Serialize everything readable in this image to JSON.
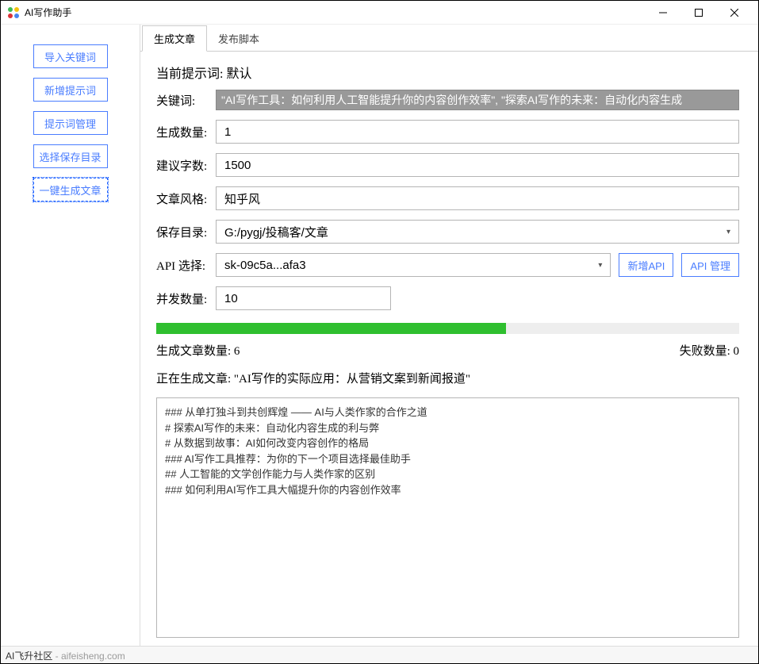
{
  "window": {
    "title": "AI写作助手"
  },
  "sidebar": {
    "import_keywords": "导入关键词",
    "add_prompt": "新增提示词",
    "manage_prompts": "提示词管理",
    "choose_save_dir": "选择保存目录",
    "one_click_generate": "一键生成文章"
  },
  "tabs": {
    "generate": "生成文章",
    "publish": "发布脚本"
  },
  "form": {
    "current_prompt_label": "当前提示词: 默认",
    "keyword_label": "关键词:",
    "keyword_value": "\"AI写作工具：如何利用人工智能提升你的内容创作效率\", \"探索AI写作的未来：自动化内容生成",
    "count_label": "生成数量:",
    "count_value": "1",
    "words_label": "建议字数:",
    "words_value": "1500",
    "style_label": "文章风格:",
    "style_value": "知乎风",
    "savedir_label": "保存目录:",
    "savedir_value": "G:/pygj/投稿客/文章",
    "api_label": "API 选择:",
    "api_value": "sk-09c5a...afa3",
    "add_api_btn": "新增API",
    "manage_api_btn": "API 管理",
    "concurrency_label": "并发数量:",
    "concurrency_value": "10"
  },
  "progress": {
    "percent": 60
  },
  "status": {
    "generated_label": "生成文章数量: ",
    "generated_count": "6",
    "failed_label": "失败数量: ",
    "failed_count": "0",
    "current_generating": "正在生成文章: \"AI写作的实际应用：从营销文案到新闻报道\""
  },
  "log": {
    "lines": [
      "### 从单打独斗到共创辉煌 —— AI与人类作家的合作之道",
      "# 探索AI写作的未来：自动化内容生成的利与弊",
      "# 从数据到故事：AI如何改变内容创作的格局",
      "### AI写作工具推荐：为你的下一个项目选择最佳助手",
      "## 人工智能的文学创作能力与人类作家的区别",
      "### 如何利用AI写作工具大幅提升你的内容创作效率"
    ]
  },
  "footer": {
    "brand": "AI飞升社区",
    "site": " - aifeisheng.com"
  }
}
